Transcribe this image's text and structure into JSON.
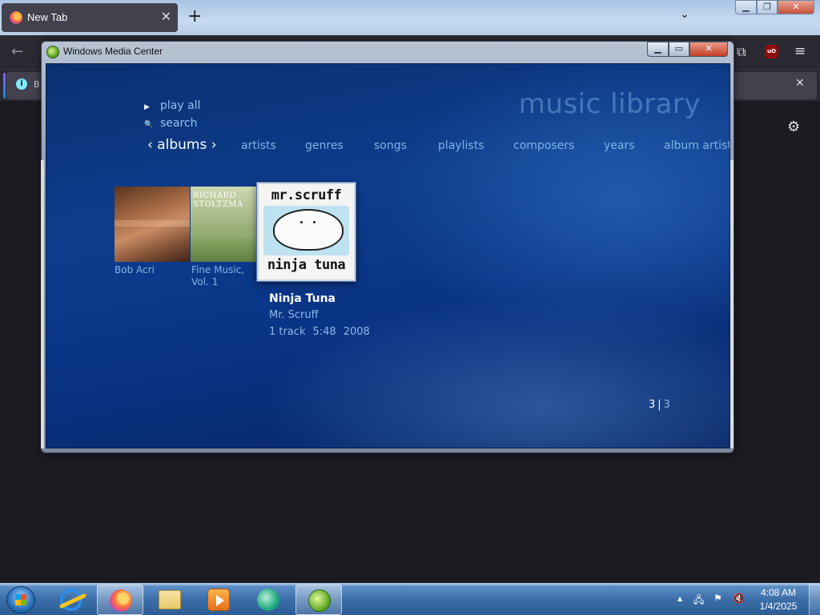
{
  "browser": {
    "tab_title": "New Tab",
    "tab_close": "✕",
    "new_tab": "+",
    "list_all_tabs": "⌄",
    "back": "←",
    "menu": "≡",
    "extensions": "⧉",
    "ublock": "uO",
    "info_icon": "i",
    "info_text": "B",
    "info_close": "✕",
    "settings": "⚙",
    "window_min": "▁",
    "window_max": "❐",
    "window_close": "✕"
  },
  "wmc": {
    "window_title": "Windows Media Center",
    "btn_min": "▁",
    "btn_max": "▭",
    "btn_close": "✕",
    "section_title": "music library",
    "commands": [
      {
        "label": "play all",
        "glyph": "▶"
      },
      {
        "label": "search",
        "glyph": "🔍"
      }
    ],
    "pivot_current": "‹ albums ›",
    "pivots": [
      "artists",
      "genres",
      "songs",
      "playlists",
      "composers",
      "years",
      "album artists"
    ],
    "albums": [
      {
        "label": "Bob Acri",
        "cover": "bob-acri-cover"
      },
      {
        "label": "Fine Music, Vol. 1",
        "label_line1": "Fine Music,",
        "label_line2": "Vol. 1",
        "cover_text_1": "RICHARD",
        "cover_text_2": "STOLTZMA"
      },
      {
        "label": "Ninja Tuna",
        "cover_text_top": "mr.scruff",
        "cover_text_bottom": "ninja tuna"
      }
    ],
    "selected": {
      "title": "Ninja Tuna",
      "artist": "Mr. Scruff",
      "tracks": "1 track",
      "duration": "5:48",
      "year": "2008"
    },
    "pager": {
      "current": "3",
      "separator": "|",
      "total": "3"
    }
  },
  "taskbar": {
    "items": [
      "start-orb",
      "internet-explorer",
      "firefox",
      "windows-explorer",
      "windows-media-player",
      "windows-live-messenger",
      "windows-media-center"
    ],
    "tray": {
      "show_hidden": "▲",
      "network": "🖧",
      "flag": "⚑",
      "volume": "🔇"
    },
    "time": "4:08 AM",
    "date": "1/4/2025"
  }
}
